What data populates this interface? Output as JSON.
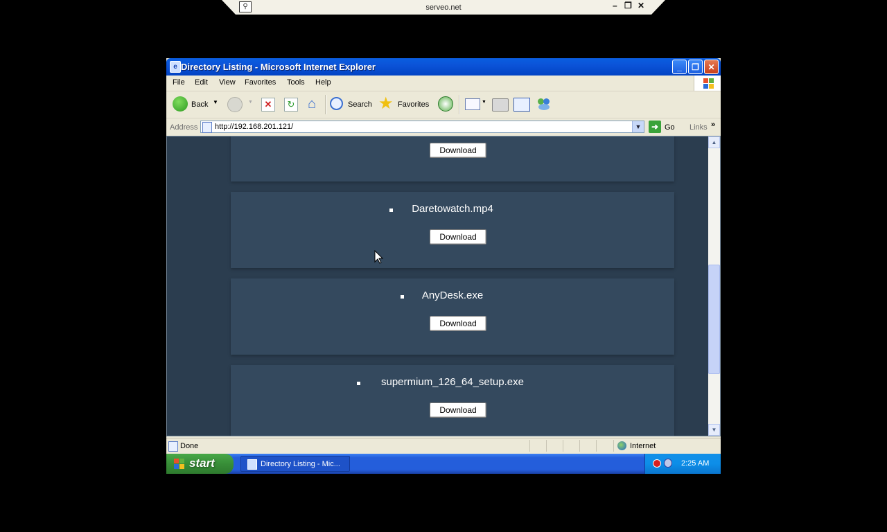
{
  "remote_bar": {
    "host": "serveo.net",
    "pin_icon": "pin-icon",
    "controls": [
      "minimize-icon",
      "restore-icon",
      "close-icon"
    ]
  },
  "window": {
    "title": "Directory Listing - Microsoft Internet Explorer",
    "menu": [
      "File",
      "Edit",
      "View",
      "Favorites",
      "Tools",
      "Help"
    ],
    "toolbar": {
      "back_label": "Back",
      "search_label": "Search",
      "favorites_label": "Favorites"
    },
    "address": {
      "label": "Address",
      "url": "http://192.168.201.121/",
      "go_label": "Go",
      "links_label": "Links"
    },
    "status": {
      "text": "Done",
      "zone": "Internet"
    }
  },
  "files": [
    {
      "name": "",
      "button": "Download"
    },
    {
      "name": "Daretowatch.mp4",
      "button": "Download"
    },
    {
      "name": "AnyDesk.exe",
      "button": "Download"
    },
    {
      "name": "supermium_126_64_setup.exe",
      "button": "Download"
    }
  ],
  "taskbar": {
    "start_label": "start",
    "task_label": "Directory Listing - Mic...",
    "clock": "2:25 AM"
  },
  "colors": {
    "page_bg": "#2b3d4f",
    "card_bg": "#34495e",
    "xp_blue": "#245edb",
    "start_green": "#388e38"
  }
}
